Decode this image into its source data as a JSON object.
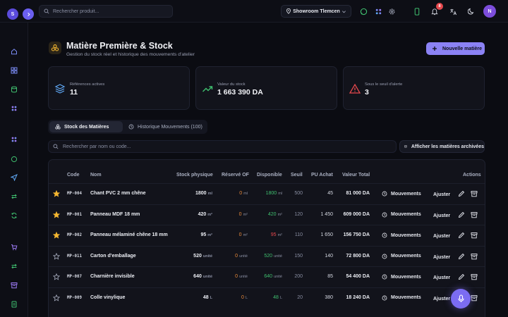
{
  "topbar": {
    "user_initial": "S",
    "search_placeholder": "Rechercher produit...",
    "showroom": "Showroom Tlemcen",
    "notification_count": "8",
    "profile_initial": "N"
  },
  "header": {
    "title": "Matière Première & Stock",
    "subtitle": "Gestion du stock réel et historique des mouvements d'atelier",
    "new_button": "Nouvelle matière"
  },
  "stats": [
    {
      "label": "Références actives",
      "value": "11",
      "icon": "layers-icon"
    },
    {
      "label": "Valeur du stock",
      "value": "1 663 390 DA",
      "icon": "trending-up-icon"
    },
    {
      "label": "Sous le seuil d'alerte",
      "value": "3",
      "icon": "warning-icon"
    }
  ],
  "tabs": [
    {
      "label": "Stock des Matières"
    },
    {
      "label": "Historique Mouvements (100)"
    }
  ],
  "filter": {
    "search_placeholder": "Rechercher par nom ou code...",
    "archive_button": "Afficher les matières archivées"
  },
  "table": {
    "headers": {
      "code": "Code",
      "nom": "Nom",
      "stock": "Stock physique",
      "reserve": "Réservé OF",
      "dispo": "Disponible",
      "seuil": "Seuil",
      "pu": "PU Achat",
      "total": "Valeur Total",
      "actions": "Actions"
    },
    "mouvements_label": "Mouvements",
    "ajuster_label": "Ajuster",
    "rows": [
      {
        "fav": true,
        "code": "MP-004",
        "nom": "Chant PVC 2 mm chêne",
        "stock": "1800",
        "stock_unit": "ml",
        "reserve": "0",
        "reserve_unit": "ml",
        "dispo": "1800",
        "dispo_unit": "ml",
        "dispo_status": "ok",
        "seuil": "500",
        "pu": "45",
        "total": "81 000 DA"
      },
      {
        "fav": true,
        "code": "MP-001",
        "nom": "Panneau MDF 18 mm",
        "stock": "420",
        "stock_unit": "m²",
        "reserve": "0",
        "reserve_unit": "m²",
        "dispo": "420",
        "dispo_unit": "m²",
        "dispo_status": "ok",
        "seuil": "120",
        "pu": "1 450",
        "total": "609 000 DA"
      },
      {
        "fav": true,
        "code": "MP-002",
        "nom": "Panneau mélaminé chêne 18 mm",
        "stock": "95",
        "stock_unit": "m²",
        "reserve": "0",
        "reserve_unit": "m²",
        "dispo": "95",
        "dispo_unit": "m²",
        "dispo_status": "low",
        "seuil": "110",
        "pu": "1 650",
        "total": "156 750 DA"
      },
      {
        "fav": false,
        "code": "MP-011",
        "nom": "Carton d'emballage",
        "stock": "520",
        "stock_unit": "unité",
        "reserve": "0",
        "reserve_unit": "unité",
        "dispo": "520",
        "dispo_unit": "unité",
        "dispo_status": "ok",
        "seuil": "150",
        "pu": "140",
        "total": "72 800 DA"
      },
      {
        "fav": false,
        "code": "MP-007",
        "nom": "Charnière invisible",
        "stock": "640",
        "stock_unit": "unité",
        "reserve": "0",
        "reserve_unit": "unité",
        "dispo": "640",
        "dispo_unit": "unité",
        "dispo_status": "ok",
        "seuil": "200",
        "pu": "85",
        "total": "54 400 DA"
      },
      {
        "fav": false,
        "code": "MP-009",
        "nom": "Colle vinylique",
        "stock": "48",
        "stock_unit": "L",
        "reserve": "0",
        "reserve_unit": "L",
        "dispo": "48",
        "dispo_unit": "L",
        "dispo_status": "ok",
        "seuil": "20",
        "pu": "380",
        "total": "18 240 DA"
      }
    ]
  },
  "colors": {
    "accent": "#8b82f4",
    "warning": "#e8893a",
    "ok": "#3fbf6f",
    "danger": "#e5484d",
    "star": "#f5b731"
  }
}
